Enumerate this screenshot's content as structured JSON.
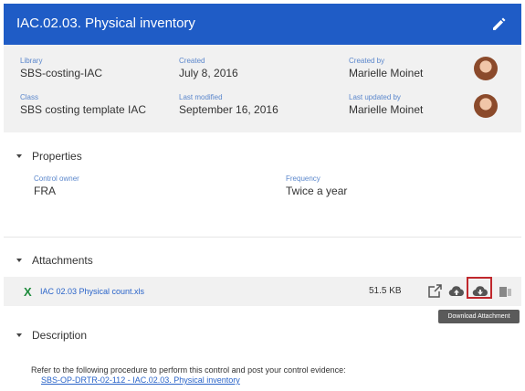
{
  "header": {
    "title": "IAC.02.03. Physical inventory"
  },
  "meta": {
    "library_label": "Library",
    "library": "SBS-costing-IAC",
    "created_label": "Created",
    "created": "July 8, 2016",
    "created_by_label": "Created by",
    "created_by": "Marielle Moinet",
    "class_label": "Class",
    "class": "SBS costing template IAC",
    "modified_label": "Last modified",
    "modified": "September 16, 2016",
    "updated_by_label": "Last updated by",
    "updated_by": "Marielle Moinet"
  },
  "properties": {
    "heading": "Properties",
    "owner_label": "Control owner",
    "owner": "FRA",
    "frequency_label": "Frequency",
    "frequency": "Twice a year"
  },
  "attachments": {
    "heading": "Attachments",
    "file_icon": "X",
    "file_name": "IAC 02.03 Physical count.xls",
    "file_size": "51.5 KB",
    "tooltip": "Download Attachment"
  },
  "description": {
    "heading": "Description",
    "text": "Refer to the following procedure to perform this control and post your control evidence:",
    "link": "SBS-OP-DRTR-02-112 - IAC.02.03. Physical inventory"
  },
  "colors": {
    "header": "#1f5cc6",
    "accent_label": "#5b87cc",
    "link": "#2a64c9",
    "highlight": "#c0282d"
  }
}
